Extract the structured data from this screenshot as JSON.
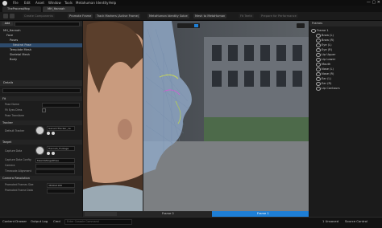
{
  "menu": [
    "File",
    "Edit",
    "Asset",
    "Window",
    "Tools",
    "Metahuman Identity",
    "Help"
  ],
  "tabs": [
    "TheProcessMap",
    "MH_Hannah"
  ],
  "toolbar": {
    "create_components": "Create Components",
    "promote_frame": "Promote Frame",
    "track_markers": "Track Markers (Active Frame)",
    "metahuman_identity_solve": "MetaHuman Identity Solve",
    "mesh_to_metahuman": "Mesh to MetaHuman",
    "fit_teeth": "Fit Teeth",
    "prepare_for_performance": "Prepare for Performance"
  },
  "outliner": {
    "header": "Add",
    "search_placeholder": "Search",
    "items": [
      "MH_Hannah",
      "Face",
      "Poses",
      "Neutral Pose",
      "Template Mesh",
      "Skeletal Mesh",
      "Body"
    ],
    "selected_index": 3
  },
  "details": {
    "tab": "Details",
    "search_placeholder": "Search",
    "sections": {
      "fit": "Fit",
      "tracker": "Tracker",
      "target": "Target",
      "camera_resolution": "Camera Resolution"
    },
    "props": {
      "pose_name": "Pose Name",
      "fit_eyes_dims": "Fit Eyes Dims",
      "pose_transform": "Pose Transform",
      "default_tracker": "Default Tracker",
      "default_tracker_value": "GenericTracker_ne",
      "capture_data": "Capture Data",
      "capture_data_value": "Hannah_Footage",
      "capture_data_config": "Capture Data Config",
      "capture_data_config_value": "MaxOGTargetPose",
      "camera": "Camera",
      "timecode_alignment": "Timecode Alignment",
      "promoted_frames_size": "Promoted Frames Size",
      "promoted_frames_size_value": "3840x2160",
      "promoted_frame_data": "Promoted Frame Data"
    }
  },
  "frames": {
    "header": "Frames",
    "items": [
      "Frame 1",
      "Brow (L)",
      "Brow (R)",
      "Eye (L)",
      "Eye (R)",
      "Lip Upper",
      "Lip Lower",
      "Mouth",
      "Nose (L)",
      "Nose (R)",
      "Ear (L)",
      "Ear (R)",
      "Lip Contours"
    ]
  },
  "viewport": {
    "frame_left": "Frame 0",
    "frame_right": "Frame 1"
  },
  "status": {
    "content_drawer": "Content Drawer",
    "output_log": "Output Log",
    "cmd": "Cmd",
    "console_placeholder": "Enter Console Command",
    "unsaved": "1 Unsaved",
    "source_control": "Source Control"
  },
  "colors": {
    "accent": "#1e7fd6",
    "selected_row": "#2d4a6b",
    "skin_overlay": "#8fa7c4"
  }
}
